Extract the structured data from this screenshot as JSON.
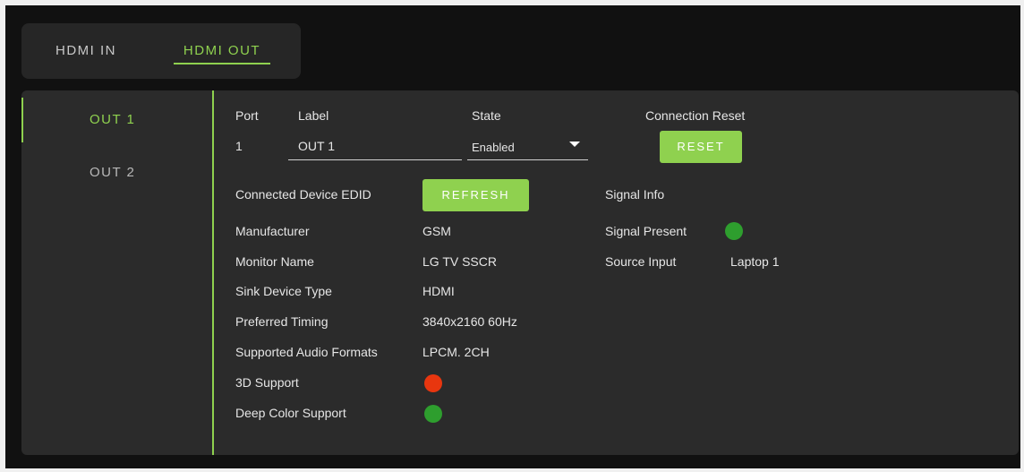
{
  "tabs": [
    {
      "label": "HDMI IN"
    },
    {
      "label": "HDMI OUT"
    }
  ],
  "sidebar": [
    {
      "label": "OUT 1"
    },
    {
      "label": "OUT 2"
    }
  ],
  "port": {
    "header_port": "Port",
    "header_label": "Label",
    "header_state": "State",
    "header_reset": "Connection Reset",
    "port_value": "1",
    "label_value": "OUT 1",
    "state_value": "Enabled",
    "reset_button": "RESET"
  },
  "edid": {
    "title": "Connected Device EDID",
    "refresh_button": "REFRESH",
    "rows": [
      {
        "label": "Manufacturer",
        "value": "GSM"
      },
      {
        "label": "Monitor Name",
        "value": "LG TV SSCR"
      },
      {
        "label": "Sink Device Type",
        "value": "HDMI"
      },
      {
        "label": "Preferred Timing",
        "value": "3840x2160 60Hz"
      },
      {
        "label": "Supported Audio Formats",
        "value": "LPCM. 2CH"
      },
      {
        "label": "3D Support",
        "status": "red"
      },
      {
        "label": "Deep Color Support",
        "status": "green"
      }
    ]
  },
  "signal": {
    "title": "Signal Info",
    "present_label": "Signal Present",
    "present_status": "green",
    "source_label": "Source Input",
    "source_value": "Laptop 1"
  },
  "colors": {
    "accent": "#8fd14f",
    "red": "#e8360f",
    "green": "#2e9e2e"
  }
}
